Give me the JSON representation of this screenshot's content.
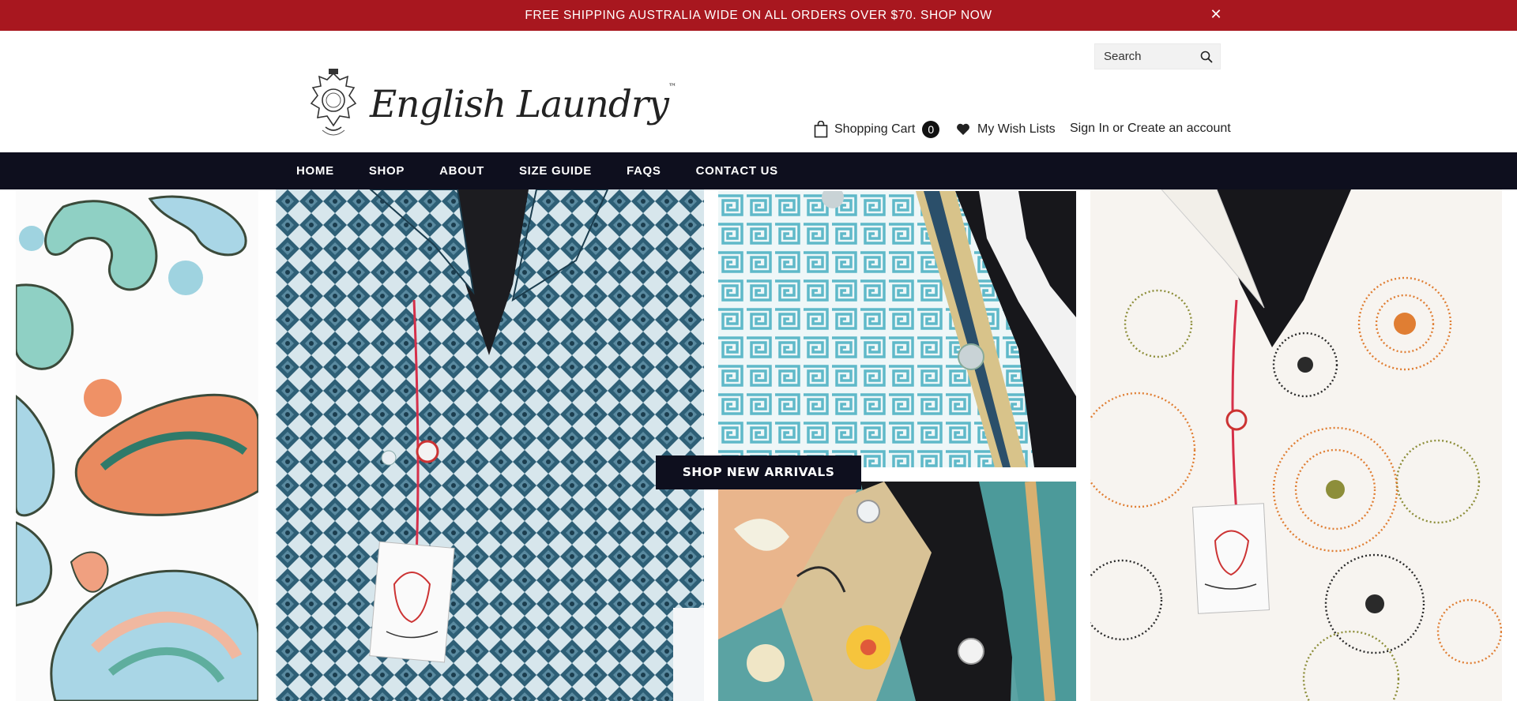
{
  "announcement": {
    "text": "FREE SHIPPING AUSTRALIA WIDE ON ALL ORDERS OVER $70. SHOP NOW",
    "close_glyph": "✕",
    "background": "#a8171f"
  },
  "header": {
    "search": {
      "placeholder": "Search",
      "icon": "search-icon"
    },
    "logo": {
      "text": "English Laundry",
      "tm": "™"
    },
    "cart": {
      "label": "Shopping Cart",
      "count": "0",
      "icon": "shopping-bag-icon"
    },
    "wishlist": {
      "label": "My Wish Lists",
      "icon": "heart-icon"
    },
    "account": {
      "sign_in": "Sign In",
      "separator": " or ",
      "create": "Create an account"
    }
  },
  "nav": {
    "background": "#0e0f1e",
    "items": [
      "HOME",
      "SHOP",
      "ABOUT",
      "SIZE GUIDE",
      "FAQS",
      "CONTACT US"
    ]
  },
  "hero": {
    "cta": "SHOP NEW ARRIVALS"
  }
}
